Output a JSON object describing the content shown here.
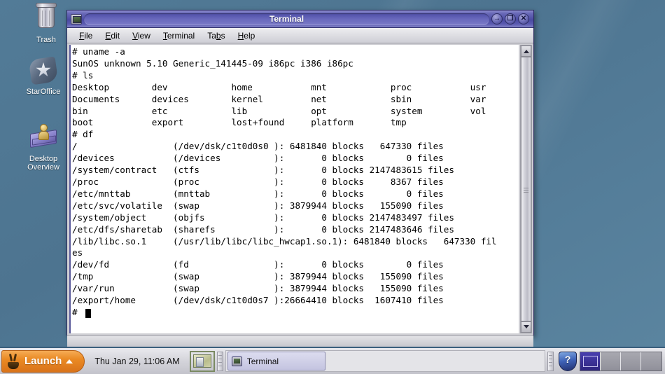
{
  "desktop": {
    "icons": [
      {
        "name": "trash",
        "label": "Trash"
      },
      {
        "name": "staroffice",
        "label": "StarOffice"
      },
      {
        "name": "desktop-overview",
        "label": "Desktop\nOverview"
      }
    ]
  },
  "window": {
    "title": "Terminal",
    "titlebar_buttons": [
      {
        "name": "minimize",
        "glyph": "→"
      },
      {
        "name": "maximize",
        "glyph": "❐"
      },
      {
        "name": "close",
        "glyph": "✕"
      }
    ],
    "menu": [
      {
        "label": "File",
        "mnemonic": "F"
      },
      {
        "label": "Edit",
        "mnemonic": "E"
      },
      {
        "label": "View",
        "mnemonic": "V"
      },
      {
        "label": "Terminal",
        "mnemonic": "T"
      },
      {
        "label": "Tabs",
        "mnemonic": "b"
      },
      {
        "label": "Help",
        "mnemonic": "H"
      }
    ],
    "terminal_text": "# uname -a\nSunOS unknown 5.10 Generic_141445-09 i86pc i386 i86pc\n# ls\nDesktop        dev            home           mnt            proc           usr\nDocuments      devices        kernel         net            sbin           var\nbin            etc            lib            opt            system         vol\nboot           export         lost+found     platform       tmp\n# df\n/                  (/dev/dsk/c1t0d0s0 ): 6481840 blocks   647330 files\n/devices           (/devices          ):       0 blocks        0 files\n/system/contract   (ctfs              ):       0 blocks 2147483615 files\n/proc              (proc              ):       0 blocks     8367 files\n/etc/mnttab        (mnttab            ):       0 blocks        0 files\n/etc/svc/volatile  (swap              ): 3879944 blocks   155090 files\n/system/object     (objfs             ):       0 blocks 2147483497 files\n/etc/dfs/sharetab  (sharefs           ):       0 blocks 2147483646 files\n/lib/libc.so.1     (/usr/lib/libc/libc_hwcap1.so.1): 6481840 blocks   647330 fil\nes\n/dev/fd            (fd                ):       0 blocks        0 files\n/tmp               (swap              ): 3879944 blocks   155090 files\n/var/run           (swap              ): 3879944 blocks   155090 files\n/export/home       (/dev/dsk/c1t0d0s7 ):26664410 blocks  1607410 files\n# ",
    "prompt_cursor": "block-cursor"
  },
  "taskbar": {
    "launch_label": "Launch",
    "clock": "Thu Jan 29, 11:06 AM",
    "tasks": [
      {
        "label": "Terminal",
        "icon": "terminal-icon",
        "active": true
      }
    ],
    "tray": {
      "help_icon_glyph": "?",
      "workspaces": [
        {
          "index": 1,
          "active": true
        },
        {
          "index": 2,
          "active": false
        },
        {
          "index": 3,
          "active": false
        },
        {
          "index": 4,
          "active": false
        }
      ]
    }
  },
  "colors": {
    "desktop_bg": "#4d7490",
    "titlebar": "#4b4ba2",
    "launch_orange": "#ea8a24",
    "terminal_bg": "#ffffff",
    "terminal_fg": "#000000",
    "workspace_active": "#2f2680"
  }
}
